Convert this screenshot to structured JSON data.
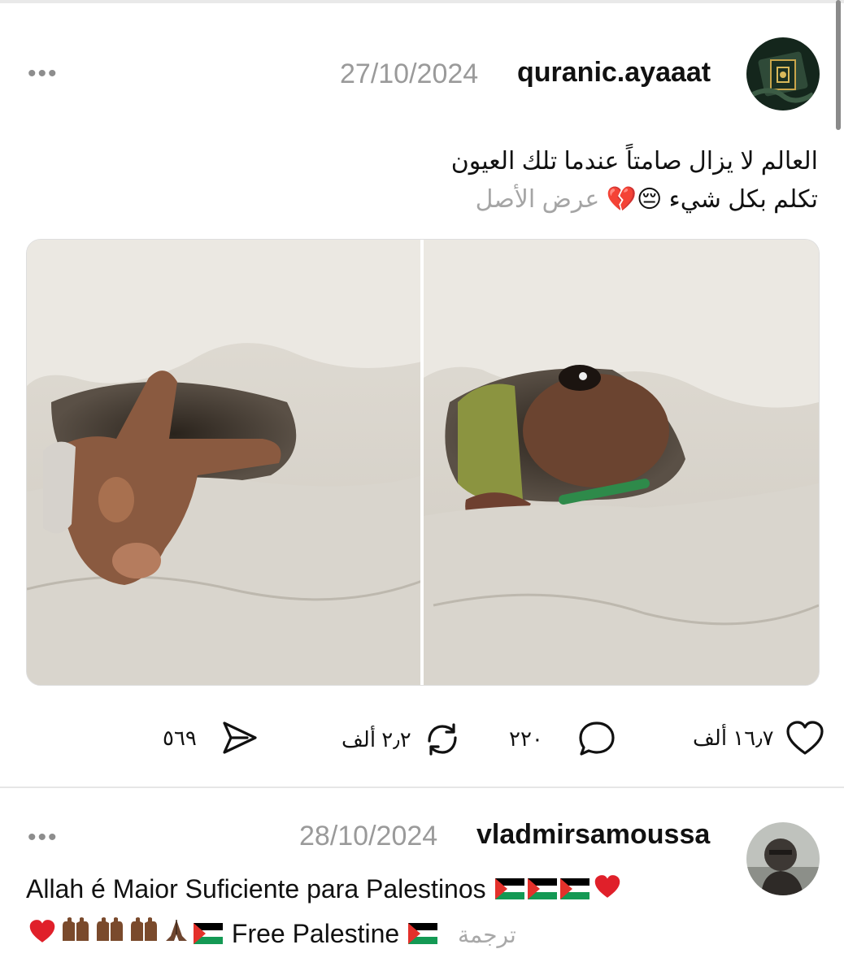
{
  "post": {
    "username": "quranic.ayaaat",
    "date": "27/10/2024",
    "more_icon": "more-dots-icon",
    "caption_line1": "العالم لا يزال صامتاً عندما تلك العيون",
    "caption_line2": "تكلم بكل شيء",
    "caption_emoji": "😔💔",
    "show_original": "عرض الأصل",
    "actions": {
      "likes": "١٦٫٧ ألف",
      "comments": "٢٢٠",
      "reposts": "٢٫٢ ألف",
      "shares": "٥٦٩"
    }
  },
  "comment": {
    "username": "vladmirsamoussa",
    "date": "28/10/2024",
    "more_icon": "more-dots-icon",
    "text_line1": "Allah é Maior Suficiente para Palestinos",
    "text_line2_suffix": "Free Palestine",
    "translate": "ترجمة"
  },
  "colors": {
    "muted": "#9a9a9a",
    "divider": "#e6e6e6",
    "heart_broken": "#e2407c"
  }
}
